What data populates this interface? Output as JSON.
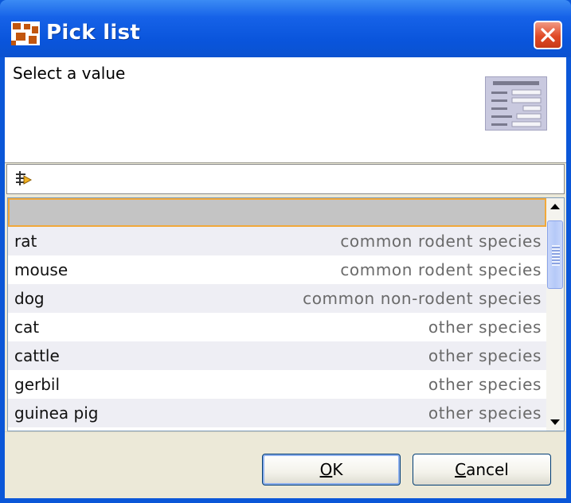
{
  "window": {
    "title": "Pick list",
    "close_label": "Close"
  },
  "banner": {
    "prompt": "Select a value",
    "icon": "form-list-icon"
  },
  "filter": {
    "icon": "filter-icon",
    "value": ""
  },
  "list": {
    "rows": [
      {
        "name": "",
        "category": ""
      },
      {
        "name": "rat",
        "category": "common rodent species"
      },
      {
        "name": "mouse",
        "category": "common rodent species"
      },
      {
        "name": "dog",
        "category": "common non-rodent species"
      },
      {
        "name": "cat",
        "category": "other species"
      },
      {
        "name": "cattle",
        "category": "other species"
      },
      {
        "name": "gerbil",
        "category": "other species"
      },
      {
        "name": "guinea pig",
        "category": "other species"
      }
    ]
  },
  "buttons": {
    "ok_mnemonic": "O",
    "ok_rest": "K",
    "cancel_mnemonic": "C",
    "cancel_rest": "ancel"
  },
  "colors": {
    "titlebar": "#0b55dc",
    "selection_outline": "#f1a83a",
    "client_bg": "#ece9d8"
  }
}
